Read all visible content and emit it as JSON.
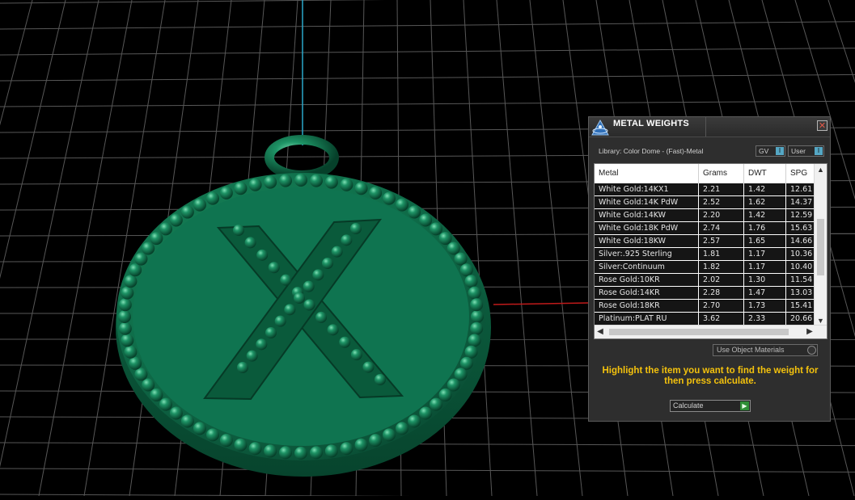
{
  "colors": {
    "background": "#000000",
    "grid": "#5a5a5a",
    "axis_y": "#2aa7c9",
    "axis_x": "#c01a1a",
    "model": "#0f6e4a",
    "instruction": "#f4c20d"
  },
  "panel": {
    "title": "METAL WEIGHTS",
    "close_icon": "✕",
    "library_label": "Library: Color Dome - (Fast)-Metal",
    "gv_label": "GV",
    "user_label": "User",
    "indicator_glyph": "I",
    "table": {
      "columns": [
        "Metal",
        "Grams",
        "DWT",
        "SPG"
      ],
      "rows": [
        {
          "metal": "White Gold:14KX1",
          "grams": "2.21",
          "dwt": "1.42",
          "spg": "12.61"
        },
        {
          "metal": "White Gold:14K PdW",
          "grams": "2.52",
          "dwt": "1.62",
          "spg": "14.37"
        },
        {
          "metal": "White Gold:14KW",
          "grams": "2.20",
          "dwt": "1.42",
          "spg": "12.59"
        },
        {
          "metal": "White Gold:18K PdW",
          "grams": "2.74",
          "dwt": "1.76",
          "spg": "15.63"
        },
        {
          "metal": "White Gold:18KW",
          "grams": "2.57",
          "dwt": "1.65",
          "spg": "14.66"
        },
        {
          "metal": "Silver:.925 Sterling",
          "grams": "1.81",
          "dwt": "1.17",
          "spg": "10.36"
        },
        {
          "metal": "Silver:Continuum",
          "grams": "1.82",
          "dwt": "1.17",
          "spg": "10.40"
        },
        {
          "metal": "Rose Gold:10KR",
          "grams": "2.02",
          "dwt": "1.30",
          "spg": "11.54"
        },
        {
          "metal": "Rose Gold:14KR",
          "grams": "2.28",
          "dwt": "1.47",
          "spg": "13.03"
        },
        {
          "metal": "Rose Gold:18KR",
          "grams": "2.70",
          "dwt": "1.73",
          "spg": "15.41"
        },
        {
          "metal": "Platinum:PLAT RU",
          "grams": "3.62",
          "dwt": "2.33",
          "spg": "20.66"
        }
      ],
      "scroll_up": "▲",
      "scroll_down": "▼",
      "scroll_left": "◀",
      "scroll_right": "▶"
    },
    "use_object_materials": "Use Object Materials",
    "instruction": "Highlight the item you want to find the weight for then press calculate.",
    "calculate_label": "Calculate",
    "calculate_go": "▶"
  },
  "model": {
    "letter": "X"
  }
}
